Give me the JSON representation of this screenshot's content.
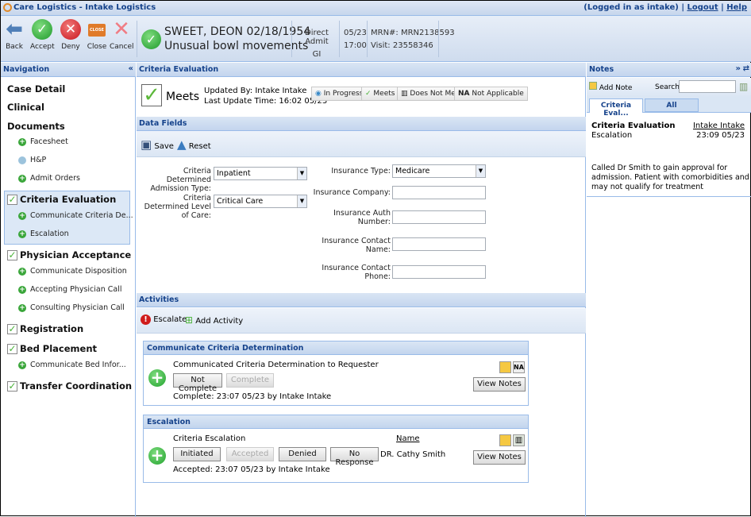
{
  "window": {
    "title": "Care Logistics - Intake Logistics",
    "logged_in": "(Logged in as intake)",
    "logout": "Logout",
    "help": "Help",
    "sep": "|"
  },
  "toolbar": {
    "back": "Back",
    "accept": "Accept",
    "deny": "Deny",
    "close": "Close",
    "close_sign": "CLOSE",
    "cancel": "Cancel"
  },
  "patient": {
    "name_dob": "SWEET, DEON 02/18/1954",
    "complaint": "Unusual bowl movements",
    "admit_type": "Direct Admit",
    "service": "GI",
    "date": "05/23",
    "time": "17:00",
    "mrn": "MRN#: MRN2138593",
    "visit": "Visit: 23558346"
  },
  "nav": {
    "title": "Navigation",
    "collapse": "«",
    "items": [
      {
        "label": "Case Detail"
      },
      {
        "label": "Clinical"
      },
      {
        "label": "Documents"
      },
      {
        "label": "Facesheet"
      },
      {
        "label": "H&P"
      },
      {
        "label": "Admit Orders"
      },
      {
        "label": "Criteria Evaluation"
      },
      {
        "label": "Communicate Criteria De..."
      },
      {
        "label": "Escalation"
      },
      {
        "label": "Physician Acceptance"
      },
      {
        "label": "Communicate Disposition"
      },
      {
        "label": "Accepting Physician Call"
      },
      {
        "label": "Consulting Physician Call"
      },
      {
        "label": "Registration"
      },
      {
        "label": "Bed Placement"
      },
      {
        "label": "Communicate Bed Infor..."
      },
      {
        "label": "Transfer Coordination"
      }
    ]
  },
  "criteria": {
    "title": "Criteria Evaluation",
    "status": "Meets",
    "updated_by": "Updated By: Intake Intake",
    "updated_time": "Last Update Time: 16:02 05/23",
    "buttons": [
      "In Progress",
      "Meets",
      "Does Not Meet",
      "Not Applicable"
    ],
    "na": "NA"
  },
  "data_fields": {
    "title": "Data Fields",
    "save": "Save",
    "reset": "Reset",
    "admission_type_label": "Criteria Determined Admission Type:",
    "admission_type": "Inpatient",
    "level_of_care_label": "Criteria Determined Level of Care:",
    "level_of_care": "Critical Care",
    "insurance_type_label": "Insurance Type:",
    "insurance_type": "Medicare",
    "insurance_company_label": "Insurance Company:",
    "insurance_company": "",
    "auth_number_label": "Insurance Auth Number:",
    "auth_number": "",
    "contact_name_label": "Insurance Contact Name:",
    "contact_name": "",
    "contact_phone_label": "Insurance Contact Phone:",
    "contact_phone": ""
  },
  "activities": {
    "title": "Activities",
    "escalate": "Escalate",
    "add_activity": "Add Activity",
    "communicate": {
      "title": "Communicate Criteria Determination",
      "desc": "Communicated Criteria Determination to Requester",
      "not_complete": "Not Complete",
      "complete": "Complete",
      "status": "Complete: 23:07 05/23 by Intake Intake",
      "view_notes": "View Notes",
      "na": "NA"
    },
    "escalation": {
      "title": "Escalation",
      "desc": "Criteria Escalation",
      "name_header": "Name",
      "name": "DR. Cathy Smith",
      "initiated": "Initiated",
      "accepted": "Accepted",
      "denied": "Denied",
      "no_response": "No Response",
      "status": "Accepted: 23:07 05/23 by Intake Intake",
      "view_notes": "View Notes"
    }
  },
  "notes": {
    "title": "Notes",
    "add_note": "Add Note",
    "search_label": "Search:",
    "search_value": "",
    "tabs": [
      "Criteria Eval...",
      "All"
    ],
    "entry": {
      "title": "Criteria Evaluation",
      "subtitle": "Escalation",
      "author": "Intake Intake",
      "time": "23:09 05/23",
      "text": "Called Dr Smith to gain approval for admission. Patient with comorbidities and may not qualify for treatment"
    }
  }
}
